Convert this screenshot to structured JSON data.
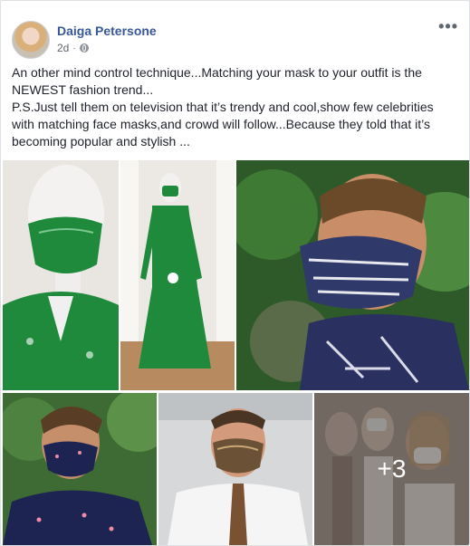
{
  "post": {
    "author": "Daiga Petersone",
    "time": "2d",
    "time_separator": "·",
    "privacy_icon": "globe-icon",
    "more_icon": "more-options-icon",
    "more_label": "•••",
    "text_line1": "An other mind control technique...Matching your mask to your outfit is the NEWEST fashion trend...",
    "text_line2": "P.S.Just tell them on television that it’s trendy and cool,show few celebrities with matching face masks,and crowd will follow...Because they told that it’s becoming popular and stylish ..."
  },
  "gallery": {
    "more_count": "+3"
  },
  "colors": {
    "author_link": "#385898",
    "mask_green": "#1f8a3c",
    "background": "#e9ebee"
  }
}
